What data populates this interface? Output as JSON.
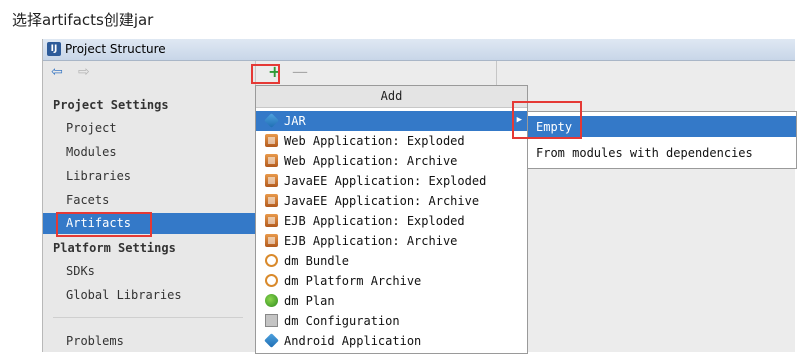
{
  "caption": "选择artifacts创建jar",
  "window": {
    "title": "Project Structure"
  },
  "leftpane": {
    "section_project": "Project Settings",
    "items_project": [
      "Project",
      "Modules",
      "Libraries",
      "Facets",
      "Artifacts"
    ],
    "selected": "Artifacts",
    "section_platform": "Platform Settings",
    "items_platform": [
      "SDKs",
      "Global Libraries"
    ],
    "problems": "Problems"
  },
  "toolbar": {
    "add_glyph": "+",
    "remove_glyph": "—"
  },
  "add_menu": {
    "header": "Add",
    "items": [
      {
        "label": "JAR",
        "icon": "jar-icon"
      },
      {
        "label": "Web Application: Exploded",
        "icon": "web-app-icon"
      },
      {
        "label": "Web Application: Archive",
        "icon": "web-app-icon"
      },
      {
        "label": "JavaEE Application: Exploded",
        "icon": "javaee-icon"
      },
      {
        "label": "JavaEE Application: Archive",
        "icon": "javaee-icon"
      },
      {
        "label": "EJB Application: Exploded",
        "icon": "ejb-icon"
      },
      {
        "label": "EJB Application: Archive",
        "icon": "ejb-icon"
      },
      {
        "label": "dm Bundle",
        "icon": "dm-bundle-icon"
      },
      {
        "label": "dm Platform Archive",
        "icon": "dm-platform-icon"
      },
      {
        "label": "dm Plan",
        "icon": "dm-plan-icon"
      },
      {
        "label": "dm Configuration",
        "icon": "dm-configuration-icon"
      },
      {
        "label": "Android Application",
        "icon": "android-icon"
      }
    ]
  },
  "submenu": {
    "items": [
      "Empty",
      "From modules with dependencies"
    ]
  },
  "colors": {
    "selection": "#3479c8",
    "highlight": "#e53935",
    "add_green": "#2f9b36"
  }
}
